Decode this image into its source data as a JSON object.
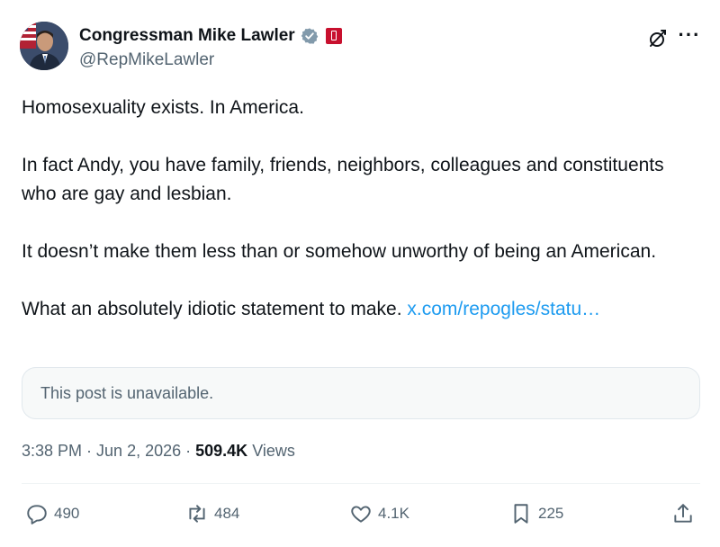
{
  "author": {
    "name": "Congressman Mike Lawler",
    "handle": "@RepMikeLawler"
  },
  "post": {
    "paragraphs": [
      "Homosexuality exists. In America.",
      "In fact Andy, you have family, friends, neighbors, colleagues and constituents who are gay and lesbian.",
      "It doesn’t make them less than or somehow unworthy of being an American."
    ],
    "last_text": "What an absolutely idiotic statement to make.",
    "link_text": "x.com/repogles/statu…"
  },
  "quote": {
    "text": "This post is unavailable."
  },
  "meta": {
    "time": "3:38 PM",
    "separator": " · ",
    "date": "Jun 2, 2026",
    "views_count": "509.4K",
    "views_label": "Views"
  },
  "actions": {
    "replies": "490",
    "reposts": "484",
    "likes": "4.1K",
    "bookmarks": "225"
  },
  "colors": {
    "link": "#1d9bf0",
    "secondary_text": "#536471",
    "verified": "#829aab",
    "gov_badge": "#c8102e"
  },
  "icons": {
    "verified": "verified-badge-icon",
    "affiliation": "government-affiliation-icon",
    "grok": "grok-icon",
    "more": "more-icon",
    "reply": "reply-icon",
    "repost": "repost-icon",
    "like": "like-icon",
    "bookmark": "bookmark-icon",
    "share": "share-icon"
  }
}
